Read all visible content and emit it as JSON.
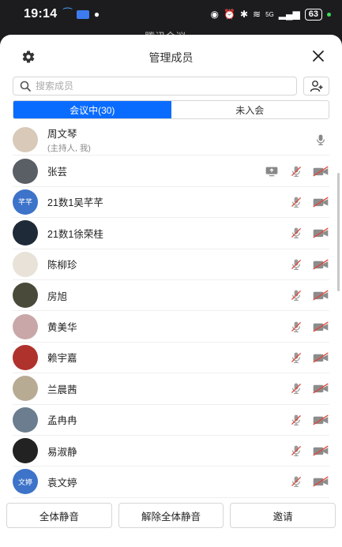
{
  "statusbar": {
    "time": "19:14",
    "battery": "63",
    "signal_label": "5G"
  },
  "behind_title": "腾讯会议 ⌄",
  "dialog": {
    "title": "管理成员",
    "search_placeholder": "搜索成员",
    "tabs": [
      {
        "label": "会议中(30)",
        "active": true
      },
      {
        "label": "未入会",
        "active": false
      }
    ]
  },
  "members": [
    {
      "name": "周文琴",
      "sub": "(主持人, 我)",
      "avatar_text": "",
      "avatar_color": "#d9c9b8",
      "icons": [
        "mic-icon"
      ]
    },
    {
      "name": "张芸",
      "sub": "",
      "avatar_text": "",
      "avatar_color": "#5a5f66",
      "icons": [
        "screen-share-icon",
        "mic-muted-icon",
        "camera-off-icon"
      ]
    },
    {
      "name": "21数1吴芊芊",
      "sub": "",
      "avatar_text": "芊芊",
      "avatar_color": "#3d73c9",
      "icons": [
        "mic-muted-icon",
        "camera-off-icon"
      ]
    },
    {
      "name": "21数1徐荣桂",
      "sub": "",
      "avatar_text": "",
      "avatar_color": "#1f2a38",
      "icons": [
        "mic-muted-icon",
        "camera-off-icon"
      ]
    },
    {
      "name": "陈柳珍",
      "sub": "",
      "avatar_text": "",
      "avatar_color": "#e8e2d8",
      "icons": [
        "mic-muted-icon",
        "camera-off-icon"
      ]
    },
    {
      "name": "房旭",
      "sub": "",
      "avatar_text": "",
      "avatar_color": "#4a4a3a",
      "icons": [
        "mic-muted-icon",
        "camera-off-icon"
      ]
    },
    {
      "name": "黄美华",
      "sub": "",
      "avatar_text": "",
      "avatar_color": "#c9a7a9",
      "icons": [
        "mic-muted-icon",
        "camera-off-icon"
      ]
    },
    {
      "name": "赖宇嘉",
      "sub": "",
      "avatar_text": "",
      "avatar_color": "#b0322c",
      "icons": [
        "mic-muted-icon",
        "camera-off-icon"
      ]
    },
    {
      "name": "兰晨茜",
      "sub": "",
      "avatar_text": "",
      "avatar_color": "#b8ab94",
      "icons": [
        "mic-muted-icon",
        "camera-off-icon"
      ]
    },
    {
      "name": "孟冉冉",
      "sub": "",
      "avatar_text": "",
      "avatar_color": "#6b7d8f",
      "icons": [
        "mic-muted-icon",
        "camera-off-icon"
      ]
    },
    {
      "name": "易淑静",
      "sub": "",
      "avatar_text": "",
      "avatar_color": "#222222",
      "icons": [
        "mic-muted-icon",
        "camera-off-icon"
      ]
    },
    {
      "name": "袁文婷",
      "sub": "",
      "avatar_text": "文婷",
      "avatar_color": "#3d73c9",
      "icons": [
        "mic-muted-icon",
        "camera-off-icon"
      ]
    }
  ],
  "bottom": {
    "mute_all": "全体静音",
    "unmute_all": "解除全体静音",
    "invite": "邀请"
  },
  "colors": {
    "accent": "#0a6cff",
    "muted_red": "#e0453a"
  }
}
